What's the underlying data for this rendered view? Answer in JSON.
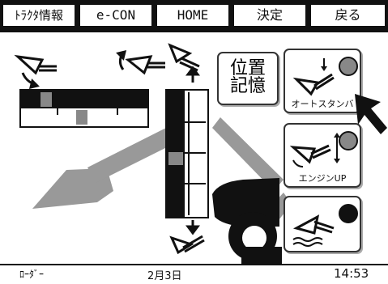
{
  "tabs": [
    {
      "label": "ﾄﾗｸﾀ情報"
    },
    {
      "label": "e-CON"
    },
    {
      "label": "HOME"
    },
    {
      "label": "決定"
    },
    {
      "label": "戻る"
    }
  ],
  "position_memory_button": {
    "label": "位置\n記憶"
  },
  "auto_standby_button": {
    "label": "オートスタンバ",
    "led_color": "#888888"
  },
  "engine_up_button": {
    "label": "エンジンUP",
    "led_color": "#888888"
  },
  "float_button": {
    "label": "",
    "led_color": "#111111"
  },
  "footer": {
    "mode": "ﾛｰﾀﾞｰ",
    "date": "2月3日",
    "time": "14:53"
  },
  "colors": {
    "bar": "#111111",
    "gauge_marker": "#888888",
    "loader_arm": "#999999",
    "led_gray": "#888888"
  },
  "icons": {
    "bucket_dump": "bucket-dump-icon",
    "bucket_crowd": "bucket-crowd-icon",
    "boom_up": "boom-up-icon",
    "boom_down": "boom-down-icon",
    "loader_arm": "loader-arm-icon",
    "tractor_wheel": "tractor-wheel-icon",
    "hand_pointer": "hand-pointer-icon"
  }
}
